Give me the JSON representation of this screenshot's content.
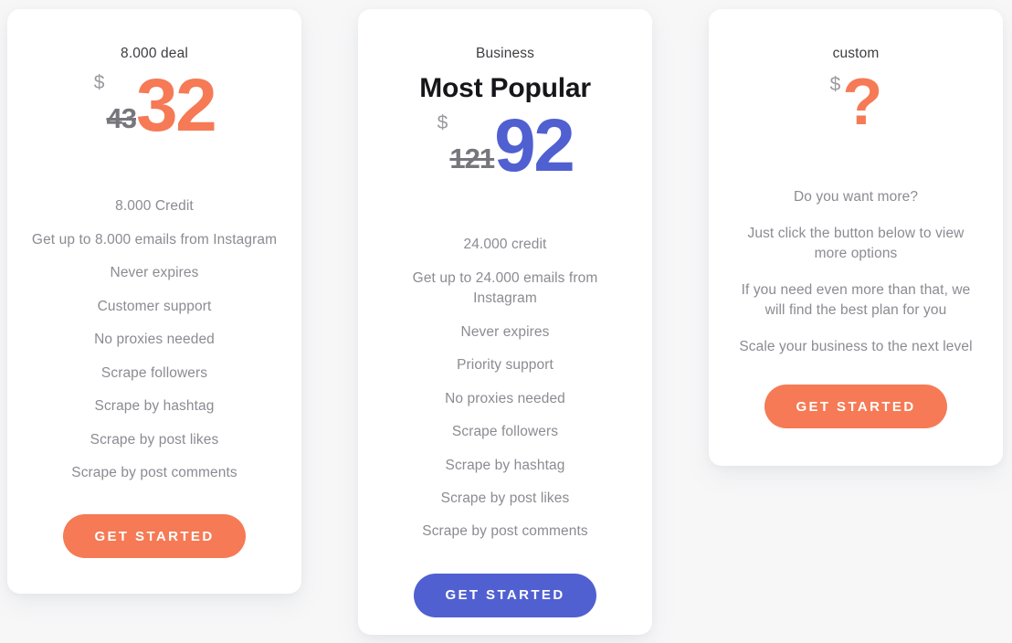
{
  "theme": {
    "background": "#f7f7f8",
    "card_background": "#ffffff",
    "accent_orange": "#f57a55",
    "accent_blue": "#5060d0",
    "muted_text": "#8b8b92",
    "old_price_text": "#76767c"
  },
  "plans": [
    {
      "id": "basic",
      "name": "8.000 deal",
      "currency": "$",
      "old_price": "43",
      "price": "32",
      "features": [
        "8.000 Credit",
        "Get up to 8.000 emails from Instagram",
        "Never expires",
        "Customer support",
        "No proxies needed",
        "Scrape followers",
        "Scrape by hashtag",
        "Scrape by post likes",
        "Scrape by post comments"
      ],
      "cta_label": "GET STARTED"
    },
    {
      "id": "business",
      "name": "Business",
      "headline": "Most Popular",
      "currency": "$",
      "old_price": "121",
      "price": "92",
      "features": [
        "24.000 credit",
        "Get up to 24.000 emails from Instagram",
        "Never expires",
        "Priority support",
        "No proxies needed",
        "Scrape followers",
        "Scrape by hashtag",
        "Scrape by post likes",
        "Scrape by post comments"
      ],
      "cta_label": "GET STARTED"
    },
    {
      "id": "custom",
      "name": "custom",
      "currency": "$",
      "price": "?",
      "features": [
        "Do you want more?",
        "Just click the button below to view more options",
        "If you need even more than that, we will find the best plan for you",
        "Scale your business to the next level"
      ],
      "cta_label": "GET STARTED"
    }
  ]
}
